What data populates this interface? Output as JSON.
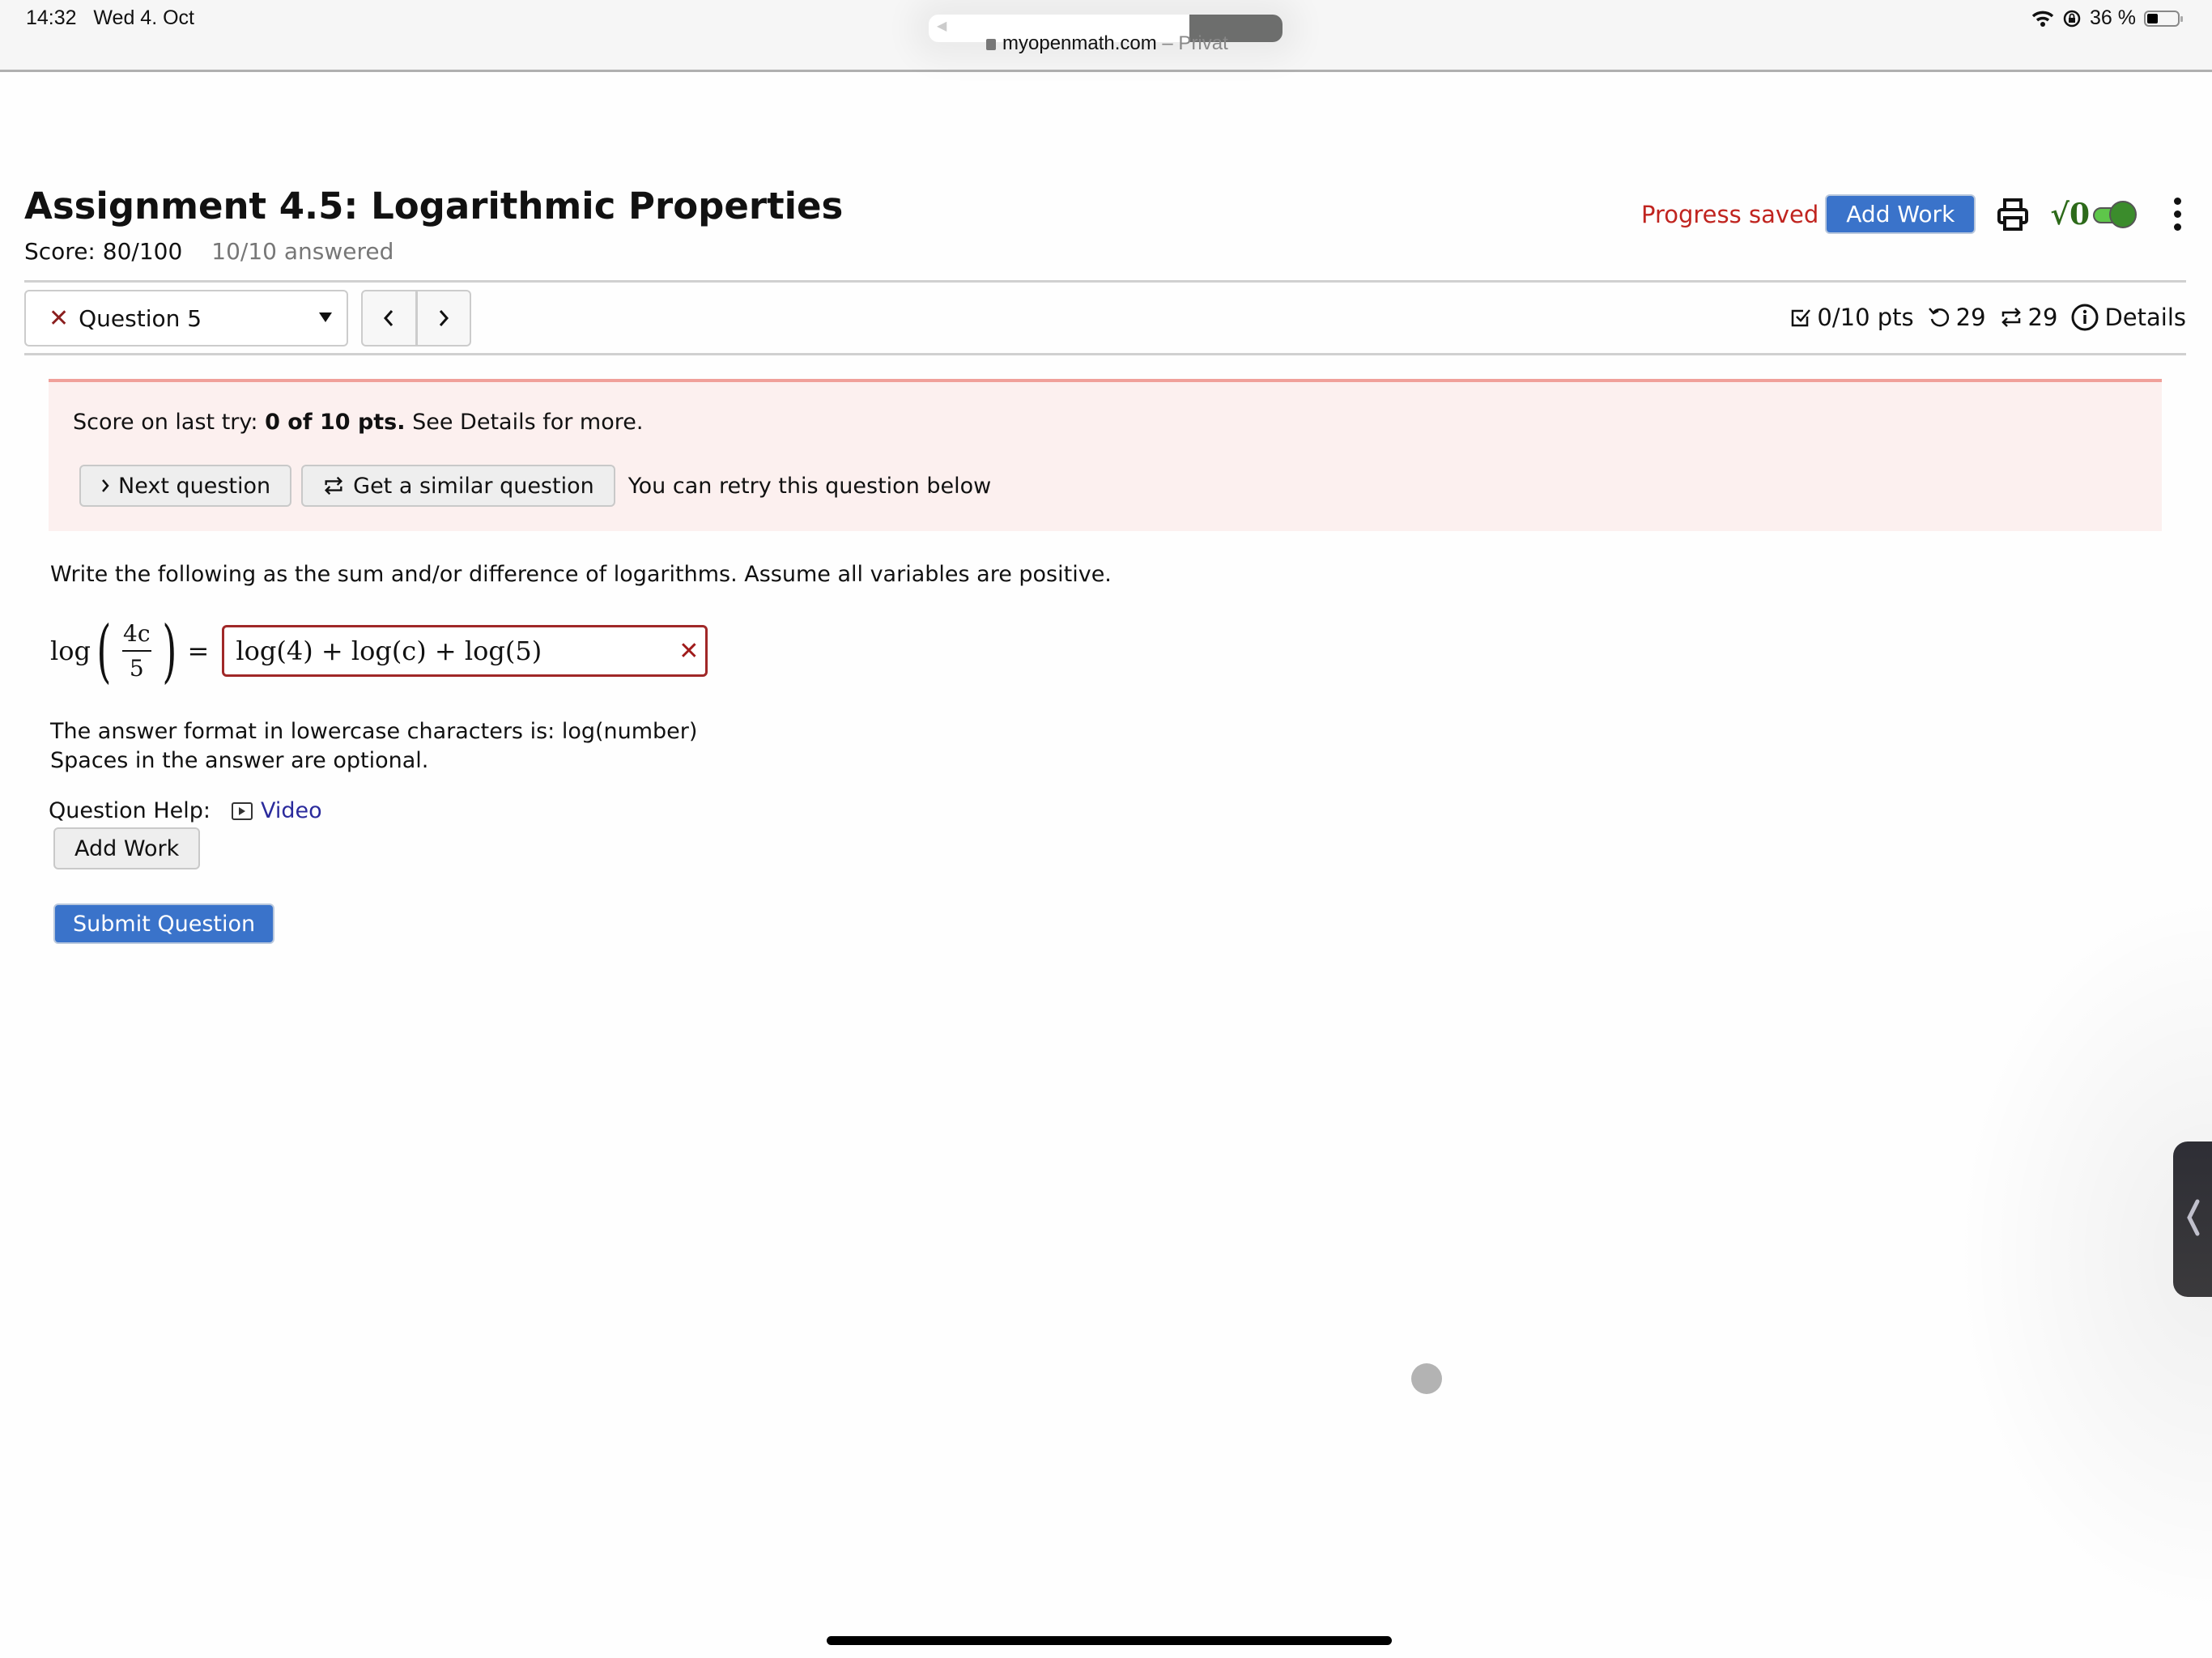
{
  "status_bar": {
    "time": "14:32",
    "date": "Wed 4. Oct",
    "battery_percent_label": "36 %",
    "battery_level": 0.36,
    "url_domain": "myopenmath.com",
    "url_suffix": " – Privat"
  },
  "header": {
    "title": "Assignment 4.5: Logarithmic Properties",
    "score": "Score: 80/100",
    "answered": "10/10 answered",
    "progress_saved": "Progress saved",
    "add_work_label": "Add Work",
    "mathquill_toggle_label": "√0",
    "mathquill_toggle_on": true
  },
  "question_nav": {
    "selected_question": "Question 5",
    "selected_status": "incorrect",
    "prev_label": "‹",
    "next_label": "›",
    "points": "0/10 pts",
    "retries": "29",
    "regens": "29",
    "details_label": "Details"
  },
  "alert": {
    "prefix": "Score on last try: ",
    "bold": "0 of 10 pts.",
    "suffix": " See Details for more.",
    "next_question_label": "Next question",
    "similar_question_label": "Get a similar question",
    "retry_text": "You can retry this question below"
  },
  "question": {
    "prompt": "Write the following as the sum and/or difference of logarithms. Assume all variables are positive.",
    "lhs_func": "log",
    "lhs_numerator": "4c",
    "lhs_denominator": "5",
    "equals": "=",
    "answer_value": "log(4) + log(c) + log(5)",
    "answer_status_icon": "✕",
    "format_line1": "The answer format in lowercase characters is: log(number)",
    "format_line2": "Spaces in the answer are optional.",
    "help_label": "Question Help:",
    "video_label": "Video",
    "add_work_label": "Add Work",
    "submit_label": "Submit Question"
  },
  "colors": {
    "primary": "#3a73ca",
    "error": "#c0241f",
    "alert_bg": "#fcf0ef",
    "alert_border": "#f0a09a",
    "link": "#2a2a9c",
    "toggle_on": "#5ec64a"
  }
}
